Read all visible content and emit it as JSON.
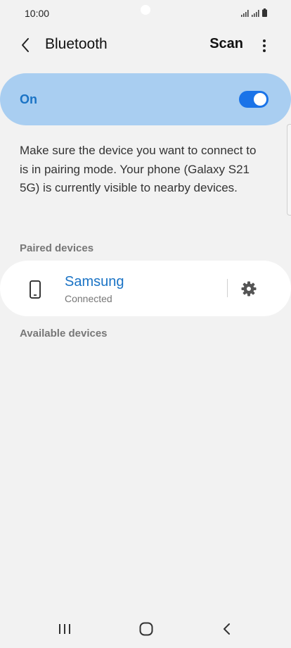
{
  "status_bar": {
    "time": "10:00",
    "icons": [
      "signal-icon",
      "signal-icon",
      "battery-icon"
    ]
  },
  "header": {
    "back_icon": "chevron-left-icon",
    "title": "Bluetooth",
    "scan_label": "Scan",
    "more_icon": "more-vertical-icon"
  },
  "toggle": {
    "label": "On",
    "checked": true,
    "accent_color": "#1a73e8",
    "card_color": "#a9cef1"
  },
  "description": "Make sure the device you want to connect to is in pairing mode. Your phone (Galaxy S21 5G) is currently visible to nearby devices.",
  "paired_devices": {
    "header": "Paired devices",
    "items": [
      {
        "icon": "phone-icon",
        "name": "Samsung",
        "status": "Connected",
        "settings_icon": "gear-icon"
      }
    ]
  },
  "available_devices": {
    "header": "Available devices"
  },
  "navbar": {
    "icons": [
      "recent-apps-icon",
      "home-icon",
      "back-icon"
    ]
  }
}
